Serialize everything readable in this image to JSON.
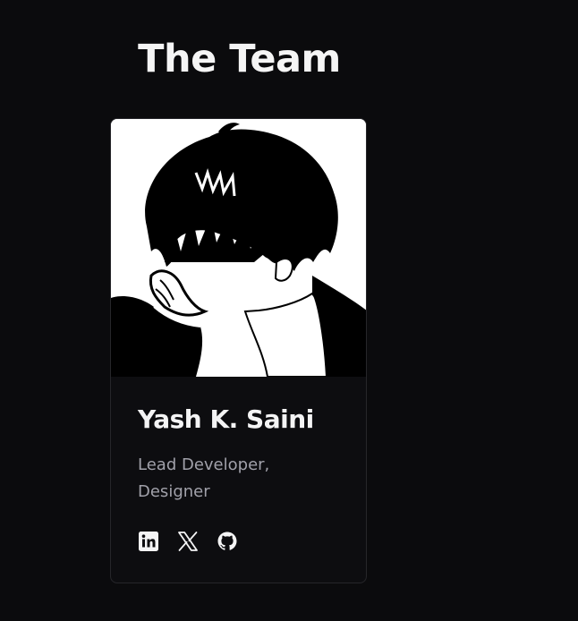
{
  "section": {
    "title": "The Team"
  },
  "members": [
    {
      "name": "Yash K. Saini",
      "role": "Lead Developer,\nDesigner",
      "photo_icon": "anime-boy-portrait",
      "socials": [
        {
          "icon": "linkedin-icon",
          "label": "LinkedIn"
        },
        {
          "icon": "x-twitter-icon",
          "label": "X"
        },
        {
          "icon": "github-icon",
          "label": "GitHub"
        }
      ]
    }
  ],
  "colors": {
    "background": "#0b0b0d",
    "card_bg": "#0d0d10",
    "card_border": "#26262a",
    "heading": "#f5f5f5",
    "muted": "#a1a1aa"
  }
}
